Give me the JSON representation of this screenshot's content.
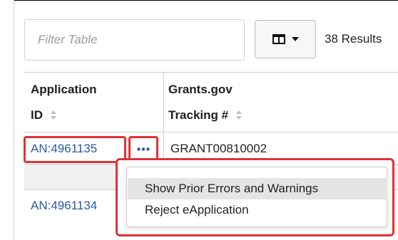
{
  "toolbar": {
    "filter_placeholder": "Filter Table",
    "filter_value": "",
    "results_label": "38 Results"
  },
  "table": {
    "columns": [
      {
        "label_line1": "Application",
        "label_line2": "ID"
      },
      {
        "label_line1": "Grants.gov",
        "label_line2": "Tracking #"
      }
    ],
    "rows": [
      {
        "application_id": "AN:4961135",
        "tracking": "GRANT00810002"
      },
      {
        "application_id": "AN:4961134",
        "tracking": ""
      }
    ]
  },
  "actions_menu": {
    "items": [
      {
        "label": "Show Prior Errors and Warnings",
        "highlighted": true
      },
      {
        "label": "Reject eApplication",
        "highlighted": false
      }
    ]
  },
  "icons": {
    "columns": "columns-icon",
    "caret": "caret-down-icon",
    "sort": "sort-icon",
    "actions": "ellipsis-icon"
  },
  "colors": {
    "link": "#2c5aa0",
    "highlight_outline": "#e0313a",
    "menu_item_hover": "#e4e4e4",
    "row_band": "#f1f1f1"
  }
}
